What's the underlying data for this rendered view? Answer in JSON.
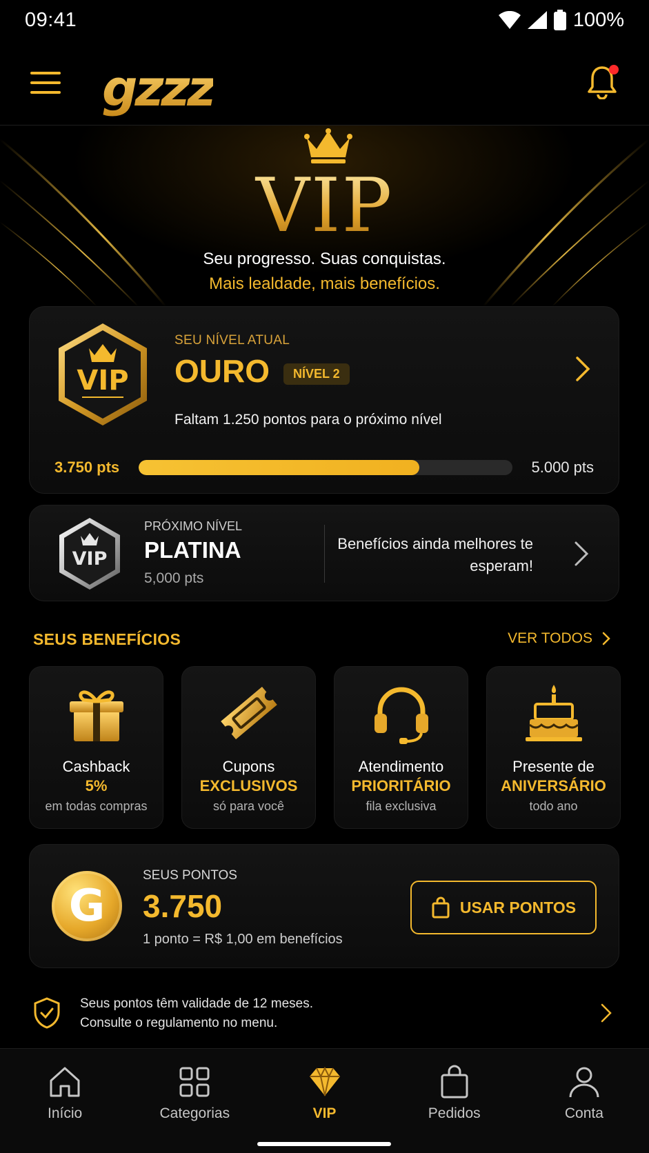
{
  "status_bar": {
    "time": "09:41",
    "battery": "100%"
  },
  "header": {
    "logo": "gzzz",
    "has_notification": true
  },
  "hero": {
    "title": "VIP",
    "subtitle_line1": "Seu progresso. Suas conquistas.",
    "subtitle_line2": "Mais lealdade, mais benefícios."
  },
  "current_level": {
    "badge_text": "VIP",
    "label": "SEU NÍVEL ATUAL",
    "name": "OURO",
    "chip": "NÍVEL 2",
    "remaining_text": "Faltam 1.250 pontos para o próximo nível",
    "current_points": "3.750 pts",
    "target_points": "5.000 pts",
    "progress_fraction": 0.75
  },
  "next_level": {
    "badge_text": "VIP",
    "label": "PRÓXIMO NÍVEL",
    "name": "PLATINA",
    "points": "5,000 pts",
    "message": "Benefícios ainda melhores te esperam!"
  },
  "benefits_section": {
    "title": "SEUS BENEFÍCIOS",
    "see_all": "VER TODOS",
    "items": [
      {
        "icon": "gift-icon",
        "line1": "Cashback",
        "line2": "5%",
        "line3": "em todas compras"
      },
      {
        "icon": "ticket-icon",
        "line1": "Cupons",
        "line2": "EXCLUSIVOS",
        "line3": "só para você"
      },
      {
        "icon": "headset-icon",
        "line1": "Atendimento",
        "line2": "PRIORITÁRIO",
        "line3": "fila exclusiva"
      },
      {
        "icon": "cake-icon",
        "line1": "Presente de",
        "line2": "ANIVERSÁRIO",
        "line3": "todo ano"
      }
    ]
  },
  "points": {
    "coin_letter": "G",
    "label": "SEUS PONTOS",
    "value": "3.750",
    "rule": "1 ponto = R$ 1,00 em benefícios",
    "button": "USAR PONTOS"
  },
  "notice": {
    "line1": "Seus pontos têm validade de 12 meses.",
    "line2": "Consulte o regulamento no menu."
  },
  "bottom_nav": {
    "items": [
      {
        "icon": "home-icon",
        "label": "Início",
        "active": false
      },
      {
        "icon": "grid-icon",
        "label": "Categorias",
        "active": false
      },
      {
        "icon": "diamond-icon",
        "label": "VIP",
        "active": true
      },
      {
        "icon": "bag-icon",
        "label": "Pedidos",
        "active": false
      },
      {
        "icon": "person-icon",
        "label": "Conta",
        "active": false
      }
    ]
  },
  "colors": {
    "accent": "#f4b92e",
    "background": "#000000",
    "card": "#121212"
  }
}
